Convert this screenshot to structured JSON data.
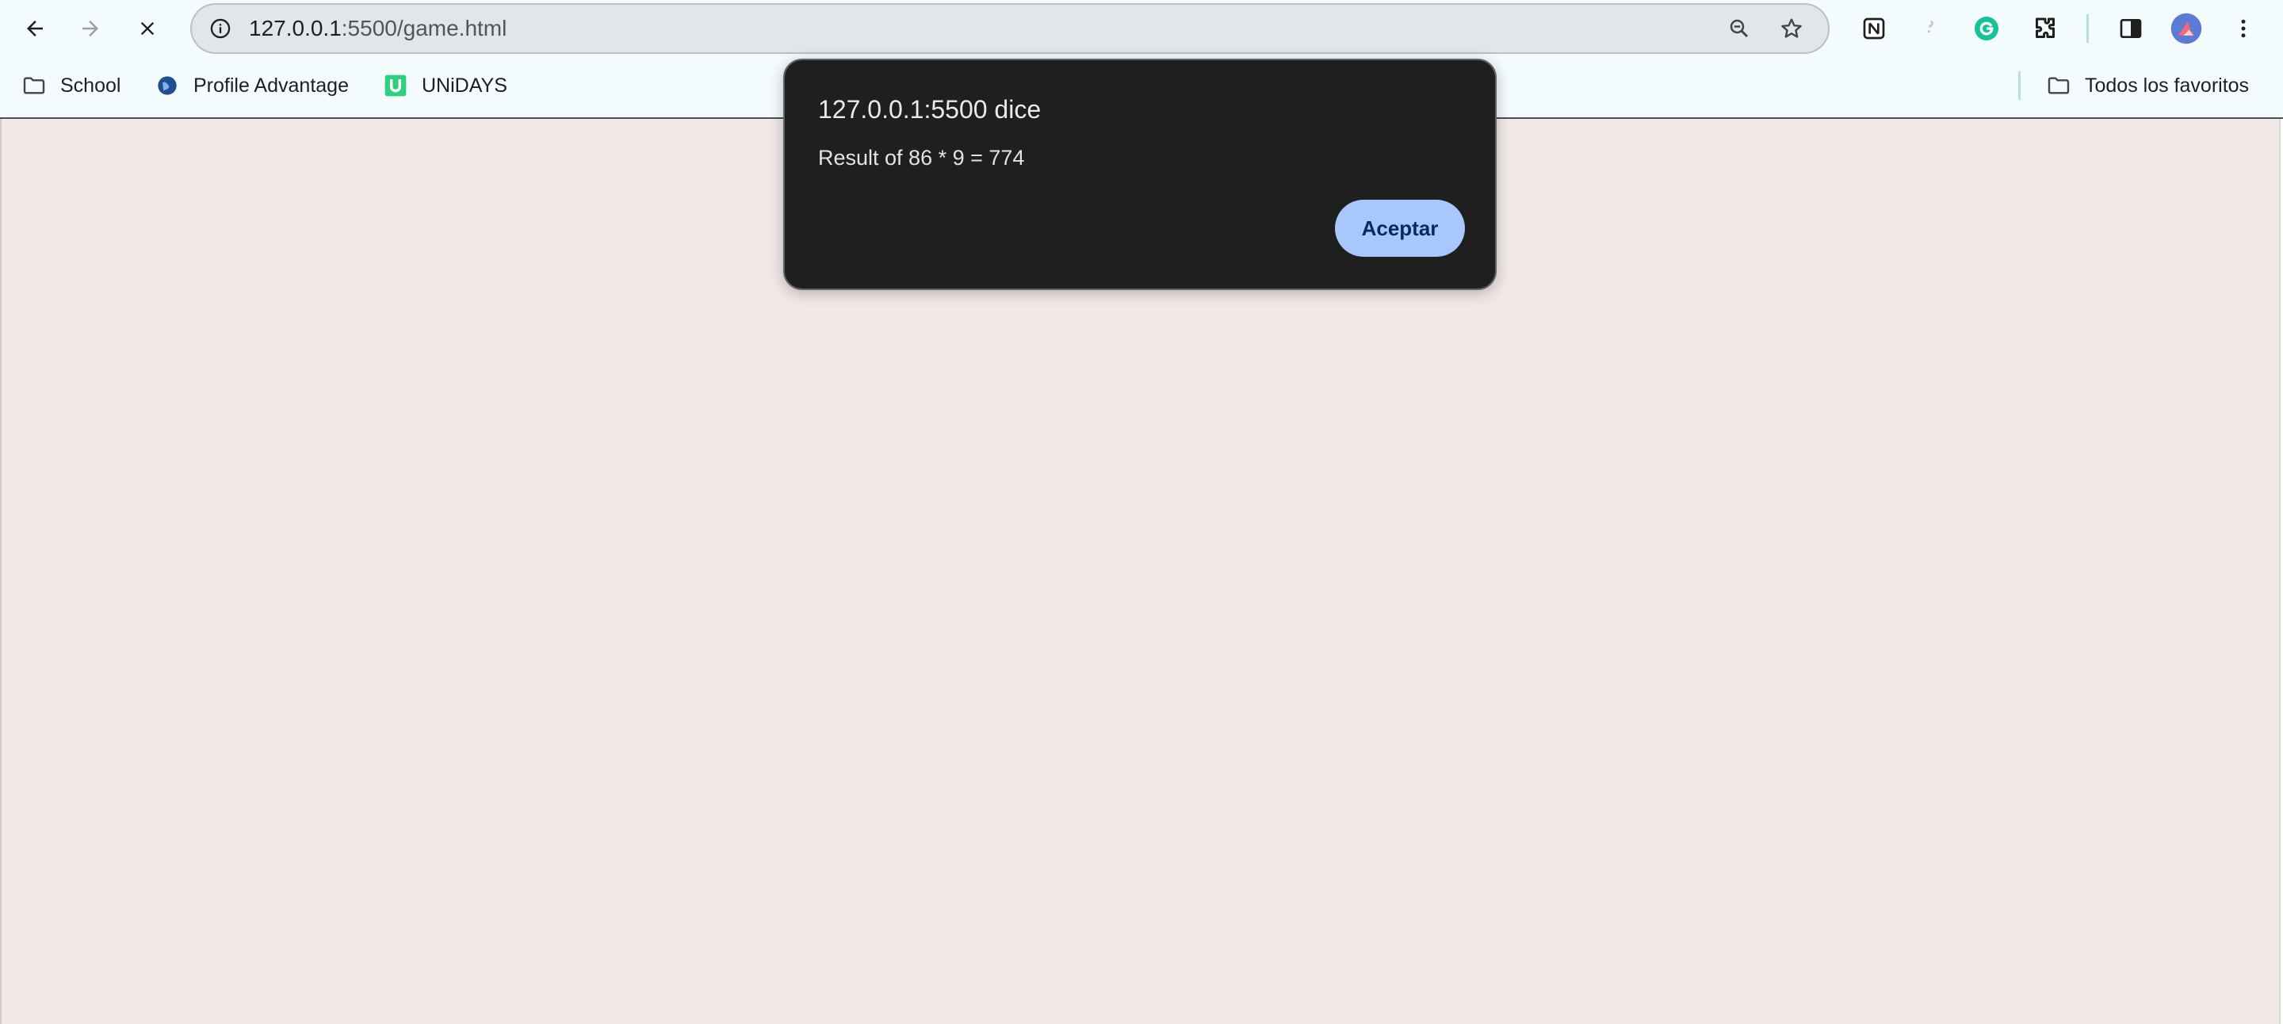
{
  "toolbar": {
    "back_icon": "arrow-left-icon",
    "forward_icon": "arrow-right-icon",
    "stop_icon": "close-icon",
    "url_host": "127.0.0.1",
    "url_path": ":5500/game.html",
    "site_info_icon": "info-icon",
    "zoom_icon": "zoom-out-icon",
    "bookmark_icon": "star-icon",
    "extensions": [
      "notion-icon",
      "extension-puzzle-piece-icon",
      "grammarly-icon",
      "puzzle-icon"
    ],
    "side_panel_icon": "side-panel-icon",
    "profile_icon": "avatar",
    "menu_icon": "more-vertical-icon"
  },
  "bookmarks": {
    "items": [
      {
        "label": "School",
        "icon": "folder-icon"
      },
      {
        "label": "Profile Advantage",
        "icon": "globe-icon"
      },
      {
        "label": "UNiDAYS",
        "icon": "unidays-icon"
      }
    ],
    "all_bookmarks": {
      "label": "Todos los favoritos",
      "icon": "folder-icon"
    }
  },
  "dialog": {
    "title": "127.0.0.1:5500 dice",
    "message": "Result of 86 * 9 = 774",
    "ok_label": "Aceptar"
  },
  "colors": {
    "page_background": "#f2e8e7",
    "dialog_background": "#1f1f1f",
    "dialog_button": "#a8c7fa",
    "toolbar_background": "#f4fbfc"
  }
}
